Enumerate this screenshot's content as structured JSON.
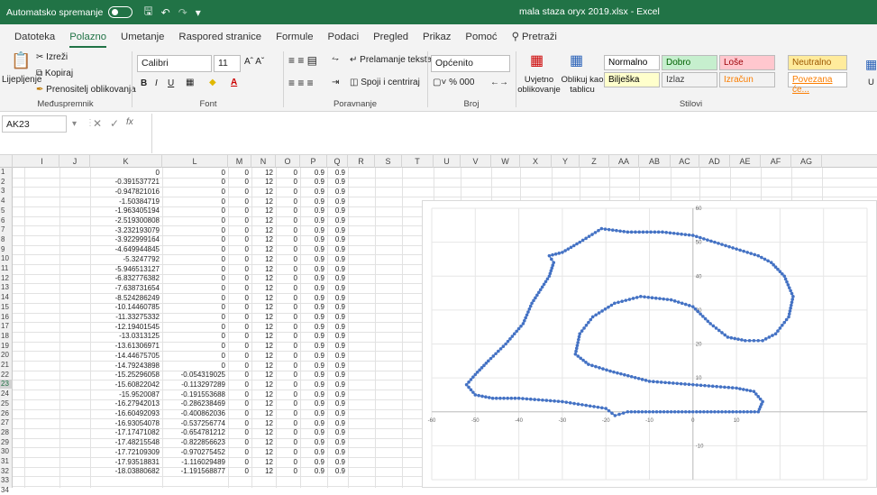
{
  "titlebar": {
    "autosave": "Automatsko spremanje",
    "title": "mala staza oryx 2019.xlsx  -  Excel"
  },
  "tabs": [
    "Datoteka",
    "Polazno",
    "Umetanje",
    "Raspored stranice",
    "Formule",
    "Podaci",
    "Pregled",
    "Prikaz",
    "Pomoć",
    "Pretraži"
  ],
  "ribbon": {
    "clipboard": {
      "paste": "Lijepljenje",
      "cut": "Izreži",
      "copy": "Kopiraj",
      "painter": "Prenositelj oblikovanja",
      "group": "Međuspremnik"
    },
    "font": {
      "name": "Calibri",
      "size": "11",
      "group": "Font"
    },
    "alignment": {
      "wrap": "Prelamanje teksta",
      "merge": "Spoji i centriraj",
      "group": "Poravnanje"
    },
    "number": {
      "format": "Općenito",
      "group": "Broj"
    },
    "styles": {
      "conditional": "Uvjetno oblikovanje",
      "table": "Oblikuj kao tablicu",
      "group": "Stilovi",
      "cells": [
        {
          "label": "Normalno",
          "bg": "#ffffff",
          "fg": "#000000"
        },
        {
          "label": "Dobro",
          "bg": "#c6efce",
          "fg": "#006100"
        },
        {
          "label": "Loše",
          "bg": "#ffc7ce",
          "fg": "#9c0006"
        },
        {
          "label": "Neutralno",
          "bg": "#ffeb9c",
          "fg": "#9c5700"
        },
        {
          "label": "Bilješka",
          "bg": "#ffffcc",
          "fg": "#000000"
        },
        {
          "label": "Izlaz",
          "bg": "#f2f2f2",
          "fg": "#3f3f3f"
        },
        {
          "label": "Izračun",
          "bg": "#f2f2f2",
          "fg": "#fa7d00"
        },
        {
          "label": "Povezana će...",
          "bg": "#ffffff",
          "fg": "#fa7d00"
        }
      ]
    }
  },
  "namebox": "AK23",
  "fx": "fx",
  "columns": [
    "I",
    "J",
    "K",
    "L",
    "M",
    "N",
    "O",
    "P",
    "Q",
    "R",
    "S",
    "T",
    "U",
    "V",
    "W",
    "X",
    "Y",
    "Z",
    "AA",
    "AB",
    "AC",
    "AD",
    "AE",
    "AF",
    "AG",
    "AH"
  ],
  "rows": [
    [
      "0",
      "0",
      "0",
      "12",
      "0",
      "0.9",
      "0.9"
    ],
    [
      "-0.391537721",
      "0",
      "0",
      "12",
      "0",
      "0.9",
      "0.9"
    ],
    [
      "-0.947821016",
      "0",
      "0",
      "12",
      "0",
      "0.9",
      "0.9"
    ],
    [
      "-1.50384719",
      "0",
      "0",
      "12",
      "0",
      "0.9",
      "0.9"
    ],
    [
      "-1.963405194",
      "0",
      "0",
      "12",
      "0",
      "0.9",
      "0.9"
    ],
    [
      "-2.519300808",
      "0",
      "0",
      "12",
      "0",
      "0.9",
      "0.9"
    ],
    [
      "-3.232193079",
      "0",
      "0",
      "12",
      "0",
      "0.9",
      "0.9"
    ],
    [
      "-3.922999164",
      "0",
      "0",
      "12",
      "0",
      "0.9",
      "0.9"
    ],
    [
      "-4.649944845",
      "0",
      "0",
      "12",
      "0",
      "0.9",
      "0.9"
    ],
    [
      "-5.3247792",
      "0",
      "0",
      "12",
      "0",
      "0.9",
      "0.9"
    ],
    [
      "-5.946513127",
      "0",
      "0",
      "12",
      "0",
      "0.9",
      "0.9"
    ],
    [
      "-6.832776382",
      "0",
      "0",
      "12",
      "0",
      "0.9",
      "0.9"
    ],
    [
      "-7.638731654",
      "0",
      "0",
      "12",
      "0",
      "0.9",
      "0.9"
    ],
    [
      "-8.524286249",
      "0",
      "0",
      "12",
      "0",
      "0.9",
      "0.9"
    ],
    [
      "-10.14460785",
      "0",
      "0",
      "12",
      "0",
      "0.9",
      "0.9"
    ],
    [
      "-11.33275332",
      "0",
      "0",
      "12",
      "0",
      "0.9",
      "0.9"
    ],
    [
      "-12.19401545",
      "0",
      "0",
      "12",
      "0",
      "0.9",
      "0.9"
    ],
    [
      "-13.0313125",
      "0",
      "0",
      "12",
      "0",
      "0.9",
      "0.9"
    ],
    [
      "-13.61306971",
      "0",
      "0",
      "12",
      "0",
      "0.9",
      "0.9"
    ],
    [
      "-14.44675705",
      "0",
      "0",
      "12",
      "0",
      "0.9",
      "0.9"
    ],
    [
      "-14.79243898",
      "0",
      "0",
      "12",
      "0",
      "0.9",
      "0.9"
    ],
    [
      "-15.25296058",
      "-0.054319025",
      "0",
      "12",
      "0",
      "0.9",
      "0.9"
    ],
    [
      "-15.60822042",
      "-0.113297289",
      "0",
      "12",
      "0",
      "0.9",
      "0.9"
    ],
    [
      "-15.9520087",
      "-0.191553688",
      "0",
      "12",
      "0",
      "0.9",
      "0.9"
    ],
    [
      "-16.27942013",
      "-0.286238469",
      "0",
      "12",
      "0",
      "0.9",
      "0.9"
    ],
    [
      "-16.60492093",
      "-0.400862036",
      "0",
      "12",
      "0",
      "0.9",
      "0.9"
    ],
    [
      "-16.93054078",
      "-0.537256774",
      "0",
      "12",
      "0",
      "0.9",
      "0.9"
    ],
    [
      "-17.17471082",
      "-0.654781212",
      "0",
      "12",
      "0",
      "0.9",
      "0.9"
    ],
    [
      "-17.48215548",
      "-0.822856623",
      "0",
      "12",
      "0",
      "0.9",
      "0.9"
    ],
    [
      "-17.72109309",
      "-0.970275452",
      "0",
      "12",
      "0",
      "0.9",
      "0.9"
    ],
    [
      "-17.93518831",
      "-1.116029489",
      "0",
      "12",
      "0",
      "0.9",
      "0.9"
    ],
    [
      "-18.03880682",
      "-1.191568877",
      "0",
      "12",
      "0",
      "0.9",
      "0.9"
    ]
  ],
  "chart_data": {
    "type": "scatter",
    "title": "",
    "xlim": [
      -60,
      40
    ],
    "ylim": [
      -20,
      60
    ],
    "x_ticks": [
      "-60",
      "-50",
      "-40",
      "-30",
      "-20",
      "-10",
      "0",
      "10"
    ],
    "y_ticks": [
      "-10",
      "10",
      "20",
      "30",
      "40",
      "50",
      "60"
    ],
    "grid": true,
    "series": [
      {
        "color": "#4472c4",
        "points": [
          [
            0,
            0
          ],
          [
            -5,
            0
          ],
          [
            -10,
            0
          ],
          [
            -15,
            0
          ],
          [
            -17.9,
            -1.1
          ],
          [
            -20,
            1
          ],
          [
            -30,
            3
          ],
          [
            -40,
            4
          ],
          [
            -46,
            4
          ],
          [
            -50,
            5
          ],
          [
            -52,
            8
          ],
          [
            -50,
            11
          ],
          [
            -47,
            15
          ],
          [
            -43,
            20
          ],
          [
            -39,
            26
          ],
          [
            -37,
            32
          ],
          [
            -35,
            36
          ],
          [
            -33,
            40
          ],
          [
            -32,
            44
          ],
          [
            -33,
            46
          ],
          [
            -30,
            47
          ],
          [
            -26,
            50
          ],
          [
            -21,
            54
          ],
          [
            -15,
            53
          ],
          [
            -7,
            53
          ],
          [
            0,
            52
          ],
          [
            5,
            50
          ],
          [
            10,
            48
          ],
          [
            15,
            46
          ],
          [
            18,
            44
          ],
          [
            21,
            40
          ],
          [
            23,
            34
          ],
          [
            22,
            28
          ],
          [
            19,
            23
          ],
          [
            16,
            21
          ],
          [
            12,
            21
          ],
          [
            8,
            22
          ],
          [
            4,
            26
          ],
          [
            0,
            31
          ],
          [
            -5,
            33
          ],
          [
            -12,
            34
          ],
          [
            -18,
            32
          ],
          [
            -23,
            28
          ],
          [
            -26,
            23
          ],
          [
            -27,
            17
          ],
          [
            -24,
            14
          ],
          [
            -19,
            12
          ],
          [
            -10,
            9
          ],
          [
            0,
            8
          ],
          [
            10,
            7
          ],
          [
            14,
            6
          ],
          [
            16,
            3
          ],
          [
            15,
            0
          ],
          [
            10,
            0
          ],
          [
            5,
            0
          ],
          [
            0,
            0
          ]
        ]
      }
    ]
  }
}
